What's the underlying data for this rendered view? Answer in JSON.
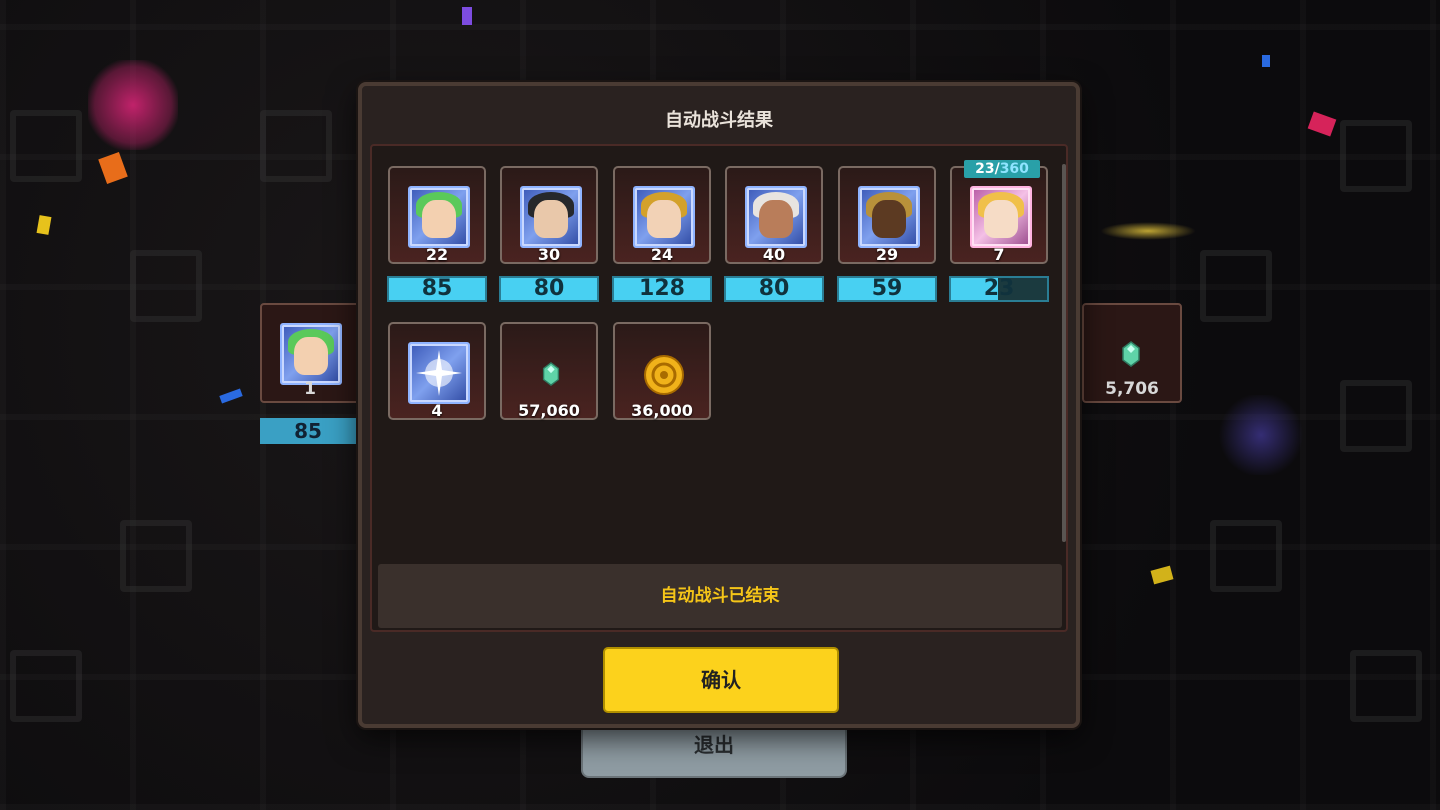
{
  "modal": {
    "title": "自动战斗结果",
    "status_text": "自动战斗已结束",
    "confirm_label": "确认"
  },
  "heroes": [
    {
      "name_icon": "hero-green-hair",
      "level": "22",
      "exp_gain": "85"
    },
    {
      "name_icon": "hero-dark-hair",
      "level": "30",
      "exp_gain": "80"
    },
    {
      "name_icon": "hero-goggles",
      "level": "24",
      "exp_gain": "128"
    },
    {
      "name_icon": "hero-bald-warrior",
      "level": "40",
      "exp_gain": "80"
    },
    {
      "name_icon": "hero-golden-armor",
      "level": "29",
      "exp_gain": "59"
    },
    {
      "name_icon": "hero-blonde-mage",
      "level": "7",
      "exp_gain": "23",
      "progress_current": "23",
      "progress_max": "360",
      "progress_fraction": 0.49
    }
  ],
  "rewards": [
    {
      "icon": "light-crystal-icon",
      "count": "4"
    },
    {
      "icon": "green-gem-icon",
      "count": "57,060"
    },
    {
      "icon": "gold-coin-icon",
      "count": "36,000"
    }
  ],
  "background": {
    "exit_label": "退出",
    "left_card_level": "1",
    "left_card_exp": "85",
    "right_card_value": "5,706"
  },
  "colors": {
    "exp_bar": "#48d0f2",
    "confirm_button": "#fcd21c",
    "status_text": "#f5c518"
  }
}
